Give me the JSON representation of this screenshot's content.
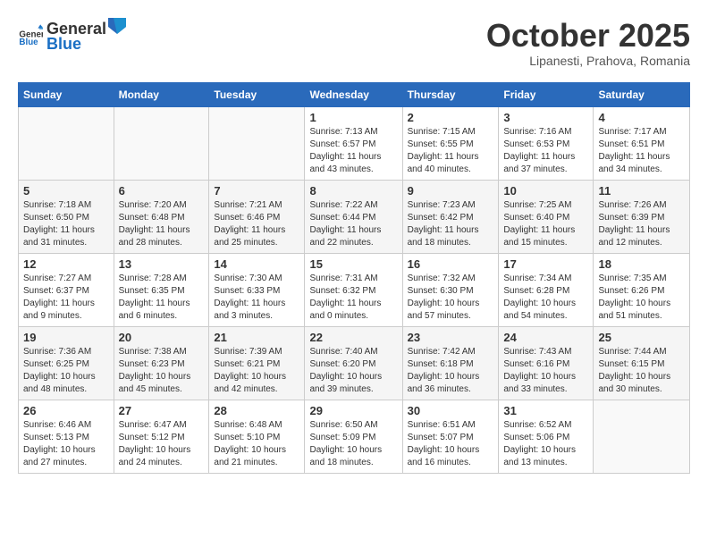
{
  "header": {
    "logo": {
      "general": "General",
      "blue": "Blue"
    },
    "title": "October 2025",
    "subtitle": "Lipanesti, Prahova, Romania"
  },
  "calendar": {
    "weekdays": [
      "Sunday",
      "Monday",
      "Tuesday",
      "Wednesday",
      "Thursday",
      "Friday",
      "Saturday"
    ],
    "weeks": [
      [
        {
          "day": "",
          "info": ""
        },
        {
          "day": "",
          "info": ""
        },
        {
          "day": "",
          "info": ""
        },
        {
          "day": "1",
          "info": "Sunrise: 7:13 AM\nSunset: 6:57 PM\nDaylight: 11 hours and 43 minutes."
        },
        {
          "day": "2",
          "info": "Sunrise: 7:15 AM\nSunset: 6:55 PM\nDaylight: 11 hours and 40 minutes."
        },
        {
          "day": "3",
          "info": "Sunrise: 7:16 AM\nSunset: 6:53 PM\nDaylight: 11 hours and 37 minutes."
        },
        {
          "day": "4",
          "info": "Sunrise: 7:17 AM\nSunset: 6:51 PM\nDaylight: 11 hours and 34 minutes."
        }
      ],
      [
        {
          "day": "5",
          "info": "Sunrise: 7:18 AM\nSunset: 6:50 PM\nDaylight: 11 hours and 31 minutes."
        },
        {
          "day": "6",
          "info": "Sunrise: 7:20 AM\nSunset: 6:48 PM\nDaylight: 11 hours and 28 minutes."
        },
        {
          "day": "7",
          "info": "Sunrise: 7:21 AM\nSunset: 6:46 PM\nDaylight: 11 hours and 25 minutes."
        },
        {
          "day": "8",
          "info": "Sunrise: 7:22 AM\nSunset: 6:44 PM\nDaylight: 11 hours and 22 minutes."
        },
        {
          "day": "9",
          "info": "Sunrise: 7:23 AM\nSunset: 6:42 PM\nDaylight: 11 hours and 18 minutes."
        },
        {
          "day": "10",
          "info": "Sunrise: 7:25 AM\nSunset: 6:40 PM\nDaylight: 11 hours and 15 minutes."
        },
        {
          "day": "11",
          "info": "Sunrise: 7:26 AM\nSunset: 6:39 PM\nDaylight: 11 hours and 12 minutes."
        }
      ],
      [
        {
          "day": "12",
          "info": "Sunrise: 7:27 AM\nSunset: 6:37 PM\nDaylight: 11 hours and 9 minutes."
        },
        {
          "day": "13",
          "info": "Sunrise: 7:28 AM\nSunset: 6:35 PM\nDaylight: 11 hours and 6 minutes."
        },
        {
          "day": "14",
          "info": "Sunrise: 7:30 AM\nSunset: 6:33 PM\nDaylight: 11 hours and 3 minutes."
        },
        {
          "day": "15",
          "info": "Sunrise: 7:31 AM\nSunset: 6:32 PM\nDaylight: 11 hours and 0 minutes."
        },
        {
          "day": "16",
          "info": "Sunrise: 7:32 AM\nSunset: 6:30 PM\nDaylight: 10 hours and 57 minutes."
        },
        {
          "day": "17",
          "info": "Sunrise: 7:34 AM\nSunset: 6:28 PM\nDaylight: 10 hours and 54 minutes."
        },
        {
          "day": "18",
          "info": "Sunrise: 7:35 AM\nSunset: 6:26 PM\nDaylight: 10 hours and 51 minutes."
        }
      ],
      [
        {
          "day": "19",
          "info": "Sunrise: 7:36 AM\nSunset: 6:25 PM\nDaylight: 10 hours and 48 minutes."
        },
        {
          "day": "20",
          "info": "Sunrise: 7:38 AM\nSunset: 6:23 PM\nDaylight: 10 hours and 45 minutes."
        },
        {
          "day": "21",
          "info": "Sunrise: 7:39 AM\nSunset: 6:21 PM\nDaylight: 10 hours and 42 minutes."
        },
        {
          "day": "22",
          "info": "Sunrise: 7:40 AM\nSunset: 6:20 PM\nDaylight: 10 hours and 39 minutes."
        },
        {
          "day": "23",
          "info": "Sunrise: 7:42 AM\nSunset: 6:18 PM\nDaylight: 10 hours and 36 minutes."
        },
        {
          "day": "24",
          "info": "Sunrise: 7:43 AM\nSunset: 6:16 PM\nDaylight: 10 hours and 33 minutes."
        },
        {
          "day": "25",
          "info": "Sunrise: 7:44 AM\nSunset: 6:15 PM\nDaylight: 10 hours and 30 minutes."
        }
      ],
      [
        {
          "day": "26",
          "info": "Sunrise: 6:46 AM\nSunset: 5:13 PM\nDaylight: 10 hours and 27 minutes."
        },
        {
          "day": "27",
          "info": "Sunrise: 6:47 AM\nSunset: 5:12 PM\nDaylight: 10 hours and 24 minutes."
        },
        {
          "day": "28",
          "info": "Sunrise: 6:48 AM\nSunset: 5:10 PM\nDaylight: 10 hours and 21 minutes."
        },
        {
          "day": "29",
          "info": "Sunrise: 6:50 AM\nSunset: 5:09 PM\nDaylight: 10 hours and 18 minutes."
        },
        {
          "day": "30",
          "info": "Sunrise: 6:51 AM\nSunset: 5:07 PM\nDaylight: 10 hours and 16 minutes."
        },
        {
          "day": "31",
          "info": "Sunrise: 6:52 AM\nSunset: 5:06 PM\nDaylight: 10 hours and 13 minutes."
        },
        {
          "day": "",
          "info": ""
        }
      ]
    ]
  }
}
